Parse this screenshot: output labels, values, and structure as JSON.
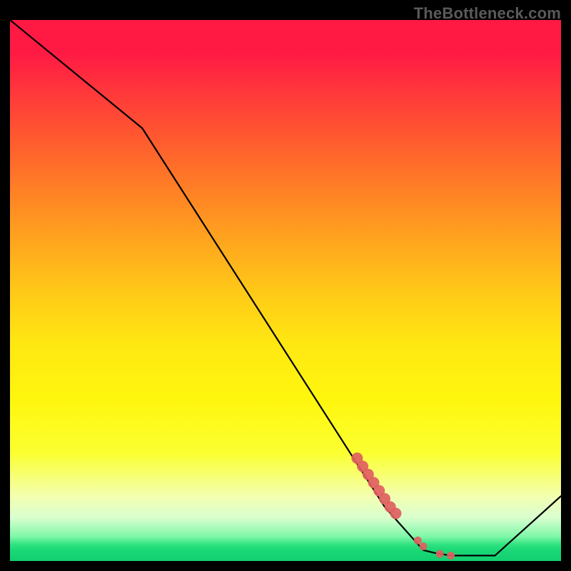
{
  "watermark": "TheBottleneck.com",
  "chart_data": {
    "type": "line",
    "title": "",
    "xlabel": "",
    "ylabel": "",
    "xlim": [
      0,
      100
    ],
    "ylim": [
      0,
      100
    ],
    "grid": false,
    "series": [
      {
        "name": "bottleneck-curve",
        "x": [
          0,
          24,
          68,
          75,
          77,
          80,
          88,
          100
        ],
        "values": [
          100,
          80,
          10,
          2,
          1.5,
          1,
          1,
          12
        ]
      }
    ],
    "marker_groups": [
      {
        "name": "cluster-a",
        "color": "#e06060",
        "radius": 8,
        "points": [
          {
            "x": 63,
            "y": 19
          },
          {
            "x": 64,
            "y": 17.5
          },
          {
            "x": 65,
            "y": 16
          },
          {
            "x": 66,
            "y": 14.5
          },
          {
            "x": 67,
            "y": 13
          },
          {
            "x": 68,
            "y": 11.5
          },
          {
            "x": 69,
            "y": 10
          },
          {
            "x": 70,
            "y": 8.8
          }
        ]
      },
      {
        "name": "cluster-b",
        "color": "#e06060",
        "radius": 5.5,
        "points": [
          {
            "x": 74,
            "y": 3.8
          },
          {
            "x": 75,
            "y": 2.7
          },
          {
            "x": 78,
            "y": 1.3
          },
          {
            "x": 80,
            "y": 1.0
          }
        ]
      }
    ],
    "gradient_stops": [
      {
        "y": 100,
        "color": "#ff1a44"
      },
      {
        "y": 50,
        "color": "#ffc818"
      },
      {
        "y": 6,
        "color": "#f3ffb0"
      },
      {
        "y": 0,
        "color": "#11d070"
      }
    ]
  }
}
